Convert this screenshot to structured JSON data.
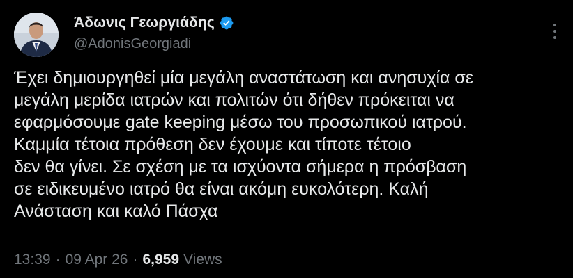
{
  "author": {
    "display_name": "Άδωνις Γεωργιάδης",
    "handle": "@AdonisGeorgiadi",
    "verified": true,
    "avatar_icon": "person-avatar"
  },
  "post": {
    "lines": [
      "Έχει δημιουργηθεί μία μεγάλη αναστάτωση και ανησυχία σε",
      "μεγάλη μερίδα ιατρών και πολιτών ότι δήθεν πρόκειται να",
      "εφαρμόσουμε gate keeping μέσω του προσωπικού ιατρού.",
      "Καμμία τέτοια πρόθεση δεν έχουμε και τίποτε τέτοιο",
      "δεν θα γίνει. Σε σχέση με τα ισχύοντα σήμερα η πρόσβαση",
      "σε ειδικευμένο ιατρό θα είναι ακόμη ευκολότερη. Καλή",
      "Ανάσταση και καλό Πάσχα"
    ]
  },
  "meta": {
    "time": "13:39",
    "separator": "·",
    "date": "09 Apr 26",
    "views_count": "6,959",
    "views_label": "Views"
  },
  "colors": {
    "background": "#000000",
    "text": "#e7e9ea",
    "muted": "#71767b",
    "verified_badge": "#1d9bf0"
  },
  "icons": {
    "verified": "verified-badge-icon",
    "more": "more-options-icon"
  }
}
